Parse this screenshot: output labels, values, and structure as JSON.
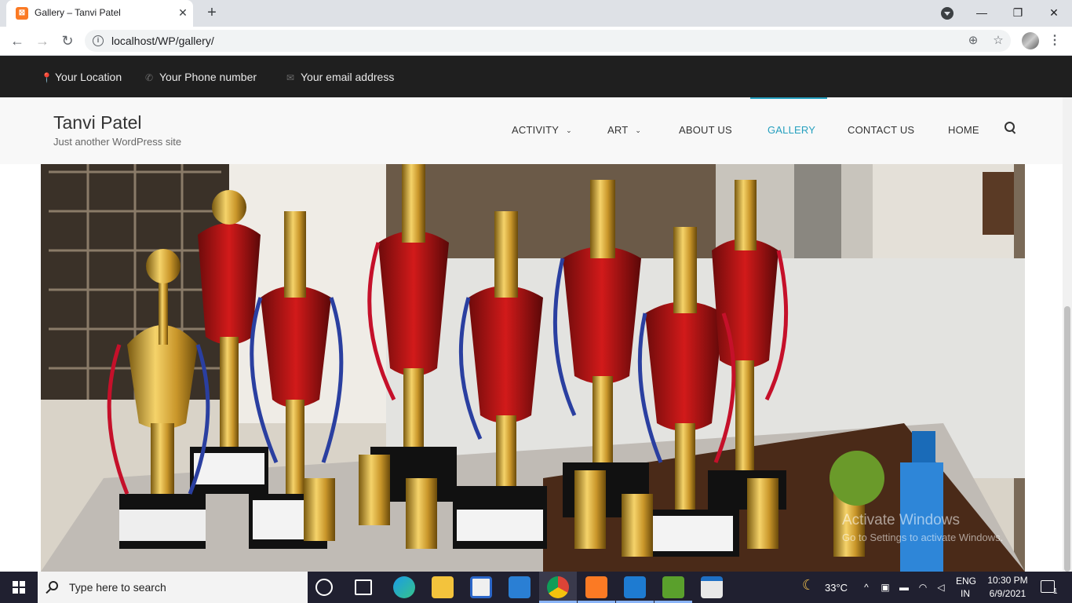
{
  "browser": {
    "tab_title": "Gallery – Tanvi Patel",
    "favicon_glyph": "⊠",
    "close_glyph": "✕",
    "new_tab_glyph": "+",
    "url": "localhost/WP/gallery/",
    "back_glyph": "←",
    "forward_glyph": "→",
    "reload_glyph": "↻",
    "zoom_glyph": "⊕",
    "star_glyph": "☆",
    "menu_glyph": "⋮",
    "minimize_glyph": "—",
    "restore_glyph": "❐",
    "close_window_glyph": "✕"
  },
  "topbar": {
    "location": "Your Location",
    "phone": "Your Phone number",
    "email": "Your email address",
    "location_icon": "📍",
    "phone_icon": "✆",
    "email_icon": "✉"
  },
  "site": {
    "title": "Tanvi Patel",
    "tagline": "Just another WordPress site",
    "accent_color": "#26a0bf"
  },
  "nav": {
    "activity": "ACTIVITY",
    "art": "ART",
    "about": "ABOUT US",
    "gallery": "GALLERY",
    "contact": "CONTACT US",
    "home": "HOME",
    "chevron": "⌄"
  },
  "watermark": {
    "line1": "Activate Windows",
    "line2": "Go to Settings to activate Windows."
  },
  "taskbar": {
    "search_placeholder": "Type here to search",
    "temperature": "33°C",
    "language_top": "ENG",
    "language_bottom": "IN",
    "time": "10:30 PM",
    "date": "6/9/2021",
    "notification_count": "1",
    "chevron_up": "^"
  }
}
